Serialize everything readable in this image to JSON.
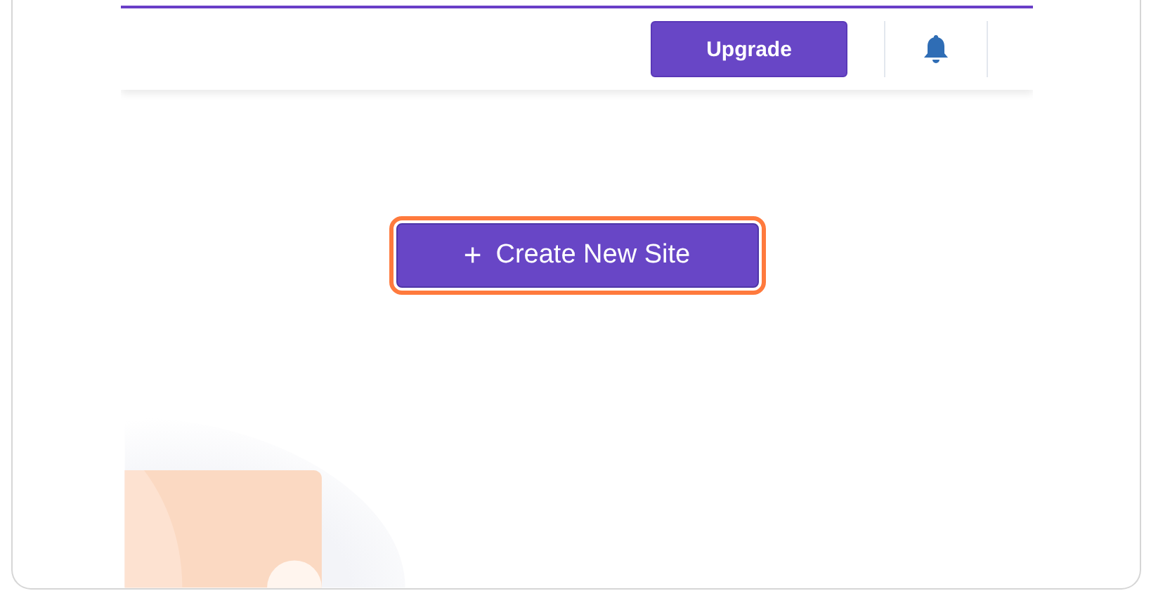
{
  "header": {
    "upgrade_button": "Upgrade"
  },
  "create_button": {
    "icon": "+",
    "label": "Create New Site"
  }
}
